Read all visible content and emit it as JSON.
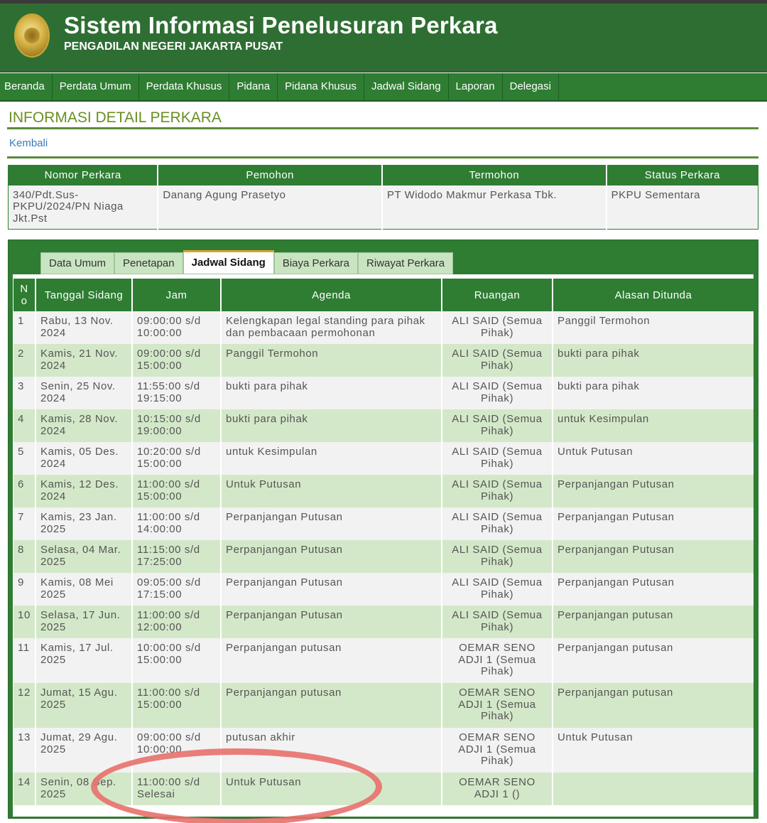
{
  "header": {
    "title": "Sistem Informasi Penelusuran Perkara",
    "subtitle": "PENGADILAN NEGERI JAKARTA PUSAT"
  },
  "nav": [
    "Beranda",
    "Perdata Umum",
    "Perdata Khusus",
    "Pidana",
    "Pidana Khusus",
    "Jadwal Sidang",
    "Laporan",
    "Delegasi"
  ],
  "section_title": "INFORMASI DETAIL PERKARA",
  "back_link": "Kembali",
  "summary": {
    "headers": [
      "Nomor Perkara",
      "Pemohon",
      "Termohon",
      "Status Perkara"
    ],
    "row": [
      "340/Pdt.Sus-PKPU/2024/PN Niaga Jkt.Pst",
      "Danang Agung Prasetyo",
      "PT Widodo Makmur Perkasa Tbk.",
      "PKPU Sementara"
    ]
  },
  "tabs": [
    "Data Umum",
    "Penetapan",
    "Jadwal Sidang",
    "Biaya Perkara",
    "Riwayat Perkara"
  ],
  "active_tab": "Jadwal Sidang",
  "schedule": {
    "headers": [
      "No",
      "Tanggal Sidang",
      "Jam",
      "Agenda",
      "Ruangan",
      "Alasan Ditunda"
    ],
    "rows": [
      [
        "1",
        "Rabu, 13 Nov. 2024",
        "09:00:00 s/d 10:00:00",
        "Kelengkapan legal standing para pihak dan pembacaan permohonan",
        "ALI SAID (Semua Pihak)",
        "Panggil Termohon"
      ],
      [
        "2",
        "Kamis, 21 Nov. 2024",
        "09:00:00 s/d 15:00:00",
        "Panggil Termohon",
        "ALI SAID (Semua Pihak)",
        "bukti para pihak"
      ],
      [
        "3",
        "Senin, 25 Nov. 2024",
        "11:55:00 s/d 19:15:00",
        "bukti para pihak",
        "ALI SAID (Semua Pihak)",
        "bukti para pihak"
      ],
      [
        "4",
        "Kamis, 28 Nov. 2024",
        "10:15:00 s/d 19:00:00",
        "bukti para pihak",
        "ALI SAID (Semua Pihak)",
        "untuk Kesimpulan"
      ],
      [
        "5",
        "Kamis, 05 Des. 2024",
        "10:20:00 s/d 15:00:00",
        "untuk Kesimpulan",
        "ALI SAID (Semua Pihak)",
        "Untuk Putusan"
      ],
      [
        "6",
        "Kamis, 12 Des. 2024",
        "11:00:00 s/d 15:00:00",
        "Untuk Putusan",
        "ALI SAID (Semua Pihak)",
        "Perpanjangan Putusan"
      ],
      [
        "7",
        "Kamis, 23 Jan. 2025",
        "11:00:00 s/d 14:00:00",
        "Perpanjangan Putusan",
        "ALI SAID (Semua Pihak)",
        "Perpanjangan Putusan"
      ],
      [
        "8",
        "Selasa, 04 Mar. 2025",
        "11:15:00 s/d 17:25:00",
        "Perpanjangan Putusan",
        "ALI SAID (Semua Pihak)",
        "Perpanjangan Putusan"
      ],
      [
        "9",
        "Kamis, 08 Mei 2025",
        "09:05:00 s/d 17:15:00",
        "Perpanjangan Putusan",
        "ALI SAID (Semua Pihak)",
        "Perpanjangan Putusan"
      ],
      [
        "10",
        "Selasa, 17 Jun. 2025",
        "11:00:00 s/d 12:00:00",
        "Perpanjangan Putusan",
        "ALI SAID (Semua Pihak)",
        "Perpanjangan putusan"
      ],
      [
        "11",
        "Kamis, 17 Jul. 2025",
        "10:00:00 s/d 15:00:00",
        "Perpanjangan putusan",
        "OEMAR SENO ADJI 1 (Semua Pihak)",
        "Perpanjangan putusan"
      ],
      [
        "12",
        "Jumat, 15 Agu. 2025",
        "11:00:00 s/d 15:00:00",
        "Perpanjangan putusan",
        "OEMAR SENO ADJI 1 (Semua Pihak)",
        "Perpanjangan putusan"
      ],
      [
        "13",
        "Jumat, 29 Agu. 2025",
        "09:00:00 s/d 10:00:00",
        "putusan akhir",
        "OEMAR SENO ADJI 1 (Semua Pihak)",
        "Untuk Putusan"
      ],
      [
        "14",
        "Senin, 08 Sep. 2025",
        "11:00:00 s/d Selesai",
        "Untuk Putusan",
        "OEMAR SENO ADJI 1 ()",
        ""
      ]
    ]
  },
  "colors": {
    "brand_green": "#2e7d32",
    "title_green": "#6b8e23",
    "row_alt": "#d3e8c8",
    "annotation_circle": "#e8706c"
  }
}
